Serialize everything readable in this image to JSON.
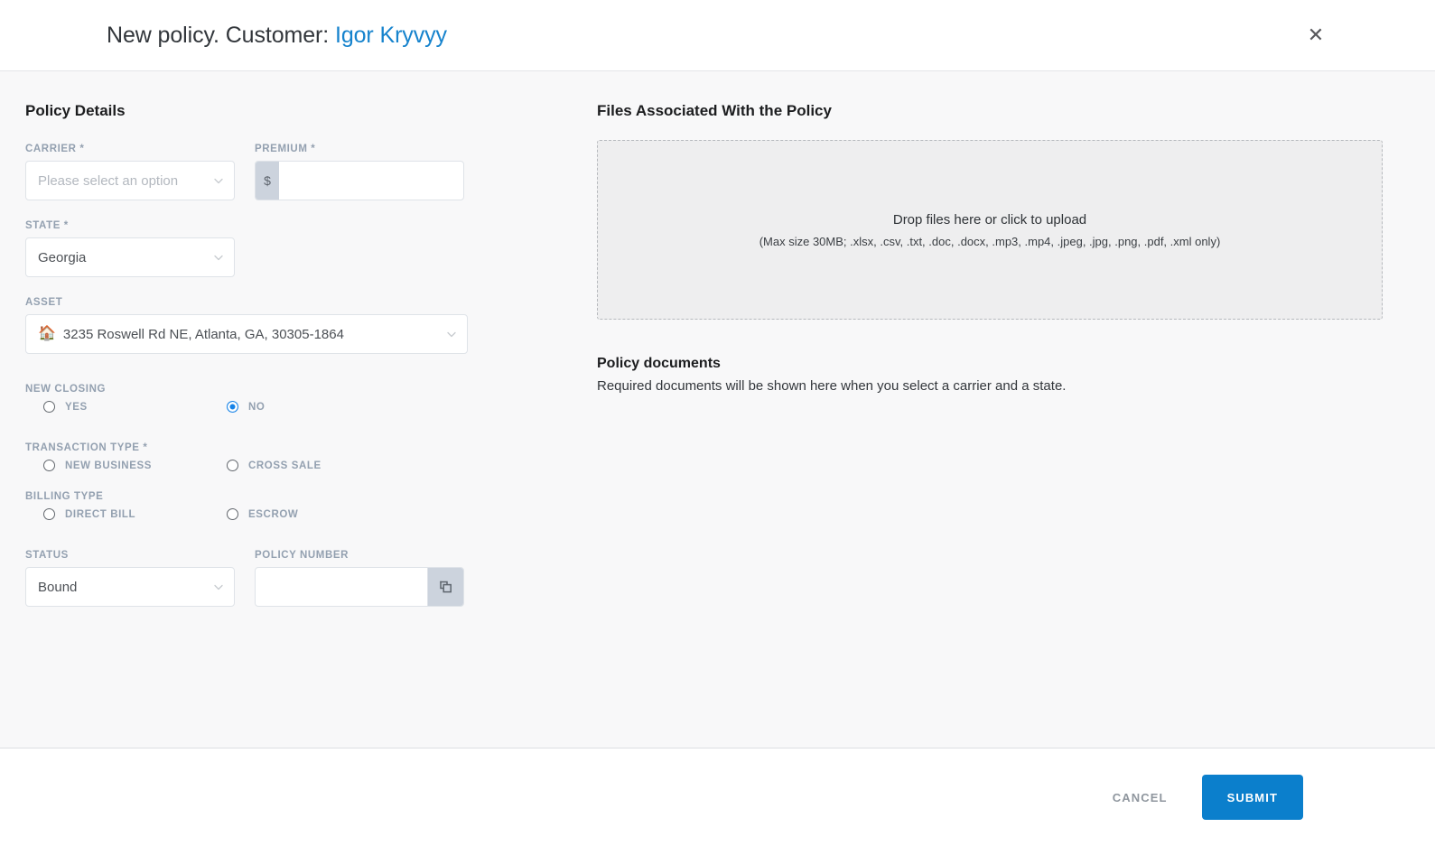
{
  "header": {
    "title_prefix": "New policy. Customer: ",
    "customer_name": "Igor Kryvyy",
    "close_label": "✕"
  },
  "left": {
    "section_title": "Policy Details",
    "carrier": {
      "label": "CARRIER *",
      "value": "Please select an option",
      "is_placeholder": true
    },
    "premium": {
      "label": "PREMIUM *",
      "addon": "$",
      "value": "",
      "placeholder": ""
    },
    "state": {
      "label": "STATE *",
      "value": "Georgia"
    },
    "asset": {
      "label": "ASSET",
      "icon": "house-emoji",
      "icon_glyph": "🏠",
      "value": "3235 Roswell Rd NE, Atlanta, GA, 30305-1864"
    },
    "new_closing": {
      "label": "NEW CLOSING",
      "options": [
        {
          "label": "YES",
          "checked": false
        },
        {
          "label": "NO",
          "checked": true
        }
      ]
    },
    "transaction_type": {
      "label": "TRANSACTION TYPE *",
      "options": [
        {
          "label": "NEW BUSINESS",
          "checked": false
        },
        {
          "label": "CROSS SALE",
          "checked": false
        }
      ]
    },
    "billing_type": {
      "label": "BILLING TYPE",
      "options": [
        {
          "label": "DIRECT BILL",
          "checked": false
        },
        {
          "label": "ESCROW",
          "checked": false
        }
      ]
    },
    "status": {
      "label": "STATUS",
      "value": "Bound"
    },
    "policy_number": {
      "label": "POLICY NUMBER",
      "value": "",
      "placeholder": "",
      "action_icon": "copy-icon"
    }
  },
  "right": {
    "section_title": "Files Associated With the Policy",
    "dropzone": {
      "main_text": "Drop files here or click to upload",
      "sub_text": "(Max size 30MB; .xlsx, .csv, .txt, .doc, .docx, .mp3, .mp4, .jpeg, .jpg, .png, .pdf, .xml only)"
    },
    "documents": {
      "title": "Policy documents",
      "description": "Required documents will be shown here when you select a carrier and a state."
    }
  },
  "footer": {
    "cancel_label": "CANCEL",
    "submit_label": "SUBMIT"
  },
  "colors": {
    "accent_link": "#1683cd",
    "primary_button": "#0b7fcc",
    "radio_selected": "#1683e8",
    "label_muted": "#93a0b0",
    "body_bg": "#f8f8f9"
  }
}
